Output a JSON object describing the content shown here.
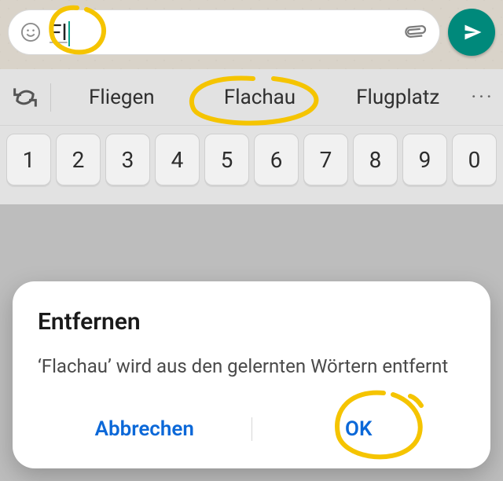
{
  "compose": {
    "text": "Fl",
    "emoji_icon": "smiley-icon",
    "attach_icon": "paperclip-icon",
    "send_icon": "send-icon"
  },
  "suggestions": {
    "refresh_icon": "refresh-icon",
    "items": [
      "Fliegen",
      "Flachau",
      "Flugplatz"
    ],
    "more": "···"
  },
  "keyboard": {
    "number_row": [
      "1",
      "2",
      "3",
      "4",
      "5",
      "6",
      "7",
      "8",
      "9",
      "0"
    ]
  },
  "dialog": {
    "title": "Entfernen",
    "message": "‘Flachau’ wird aus den gelernten Wörtern entfernt",
    "cancel": "Abbrechen",
    "ok": "OK"
  },
  "annotations": {
    "fl": "circled-input-text",
    "flachau": "circled-suggestion",
    "ok": "circled-ok-button"
  }
}
